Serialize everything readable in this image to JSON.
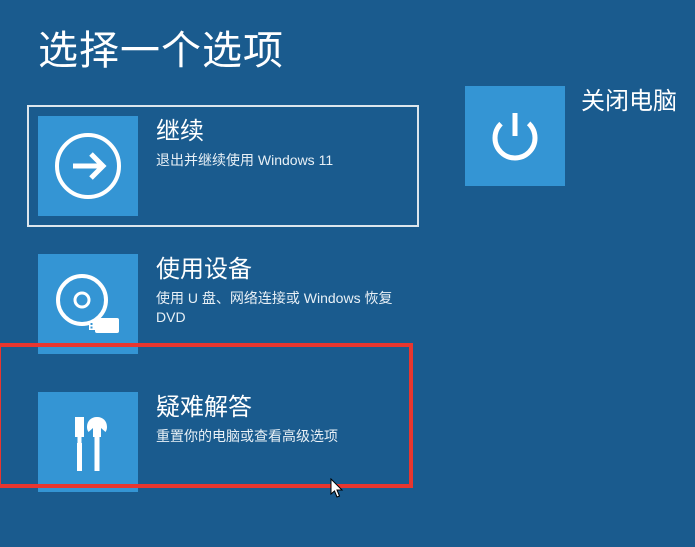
{
  "title": "选择一个选项",
  "options": {
    "continue": {
      "title": "继续",
      "desc": "退出并继续使用 Windows 11"
    },
    "use_device": {
      "title": "使用设备",
      "desc": "使用 U 盘、网络连接或 Windows 恢复 DVD"
    },
    "troubleshoot": {
      "title": "疑难解答",
      "desc": "重置你的电脑或查看高级选项"
    },
    "shutdown": {
      "title": "关闭电脑"
    }
  }
}
